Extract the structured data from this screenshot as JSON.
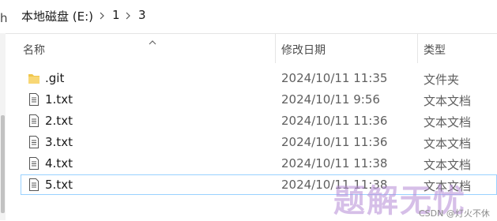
{
  "address": {
    "edge_glyph": "h",
    "crumbs": [
      "本地磁盘 (E:)",
      "1",
      "3"
    ]
  },
  "columns": {
    "name": "名称",
    "modified": "修改日期",
    "type": "类型"
  },
  "files": [
    {
      "name": ".git",
      "modified": "2024/10/11 11:35",
      "type": "文件夹",
      "icon": "folder-icon"
    },
    {
      "name": "1.txt",
      "modified": "2024/10/11 9:56",
      "type": "文本文档",
      "icon": "text-file-icon"
    },
    {
      "name": "2.txt",
      "modified": "2024/10/11 11:36",
      "type": "文本文档",
      "icon": "text-file-icon"
    },
    {
      "name": "3.txt",
      "modified": "2024/10/11 11:36",
      "type": "文本文档",
      "icon": "text-file-icon"
    },
    {
      "name": "4.txt",
      "modified": "2024/10/11 11:38",
      "type": "文本文档",
      "icon": "text-file-icon"
    },
    {
      "name": "5.txt",
      "modified": "2024/10/11 11:38",
      "type": "文本文档",
      "icon": "text-file-icon",
      "selected": true
    }
  ],
  "watermark": {
    "main": "题解无忧",
    "sub": "CSDN @灯火不休"
  },
  "colors": {
    "folder": "#f0c64b",
    "selection_border": "#99d1ff"
  }
}
